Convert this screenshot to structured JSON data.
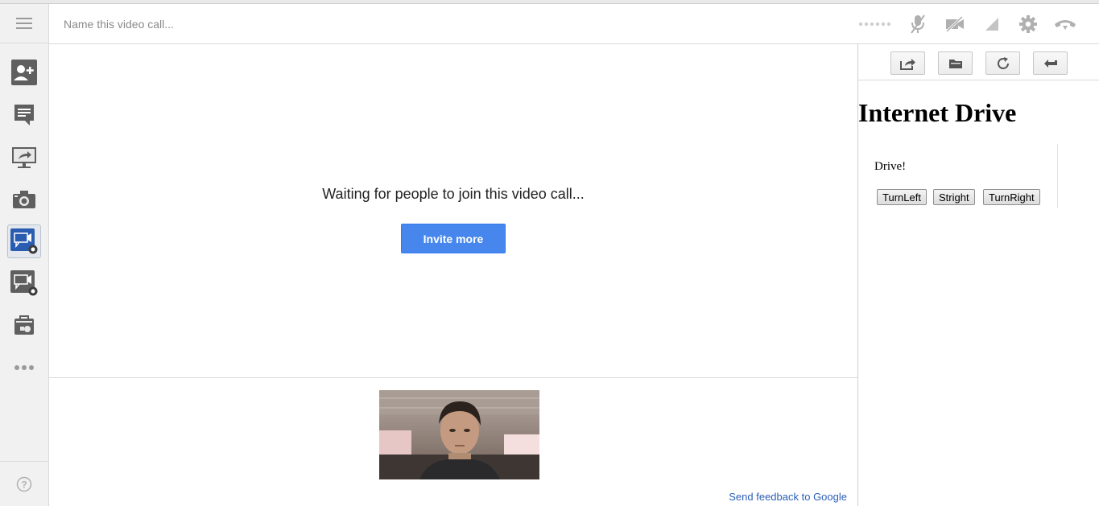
{
  "top_bar": {
    "call_name_placeholder": "Name this video call...",
    "controls": [
      "signal-dots-icon",
      "mute-mic-icon",
      "camera-off-icon",
      "bandwidth-icon",
      "settings-gear-icon",
      "hang-up-icon"
    ]
  },
  "sidebar": {
    "items": [
      {
        "icon": "invite-person-icon"
      },
      {
        "icon": "chat-icon"
      },
      {
        "icon": "screenshare-icon"
      },
      {
        "icon": "capture-camera-icon"
      },
      {
        "icon": "hangout-app-icon",
        "active": true
      },
      {
        "icon": "hangout-app-icon"
      },
      {
        "icon": "app-gallery-icon"
      },
      {
        "icon": "more-dots-icon"
      }
    ],
    "help_icon": "help-icon"
  },
  "main": {
    "waiting_text": "Waiting for people to join this video call...",
    "invite_label": "Invite more"
  },
  "filmstrip": {
    "feedback_link": "Send feedback to Google"
  },
  "right_panel": {
    "toolbar_icons": [
      "share-icon",
      "folder-icon",
      "refresh-icon",
      "back-arrow-icon"
    ],
    "title": "Internet Drive",
    "drive_text": "Drive!",
    "buttons": {
      "turn_left": "TurnLeft",
      "straight": "Stright",
      "turn_right": "TurnRight"
    }
  },
  "colors": {
    "accent_blue": "#4787ed",
    "link_blue": "#2b5fb8",
    "icon_grey": "#606060"
  }
}
